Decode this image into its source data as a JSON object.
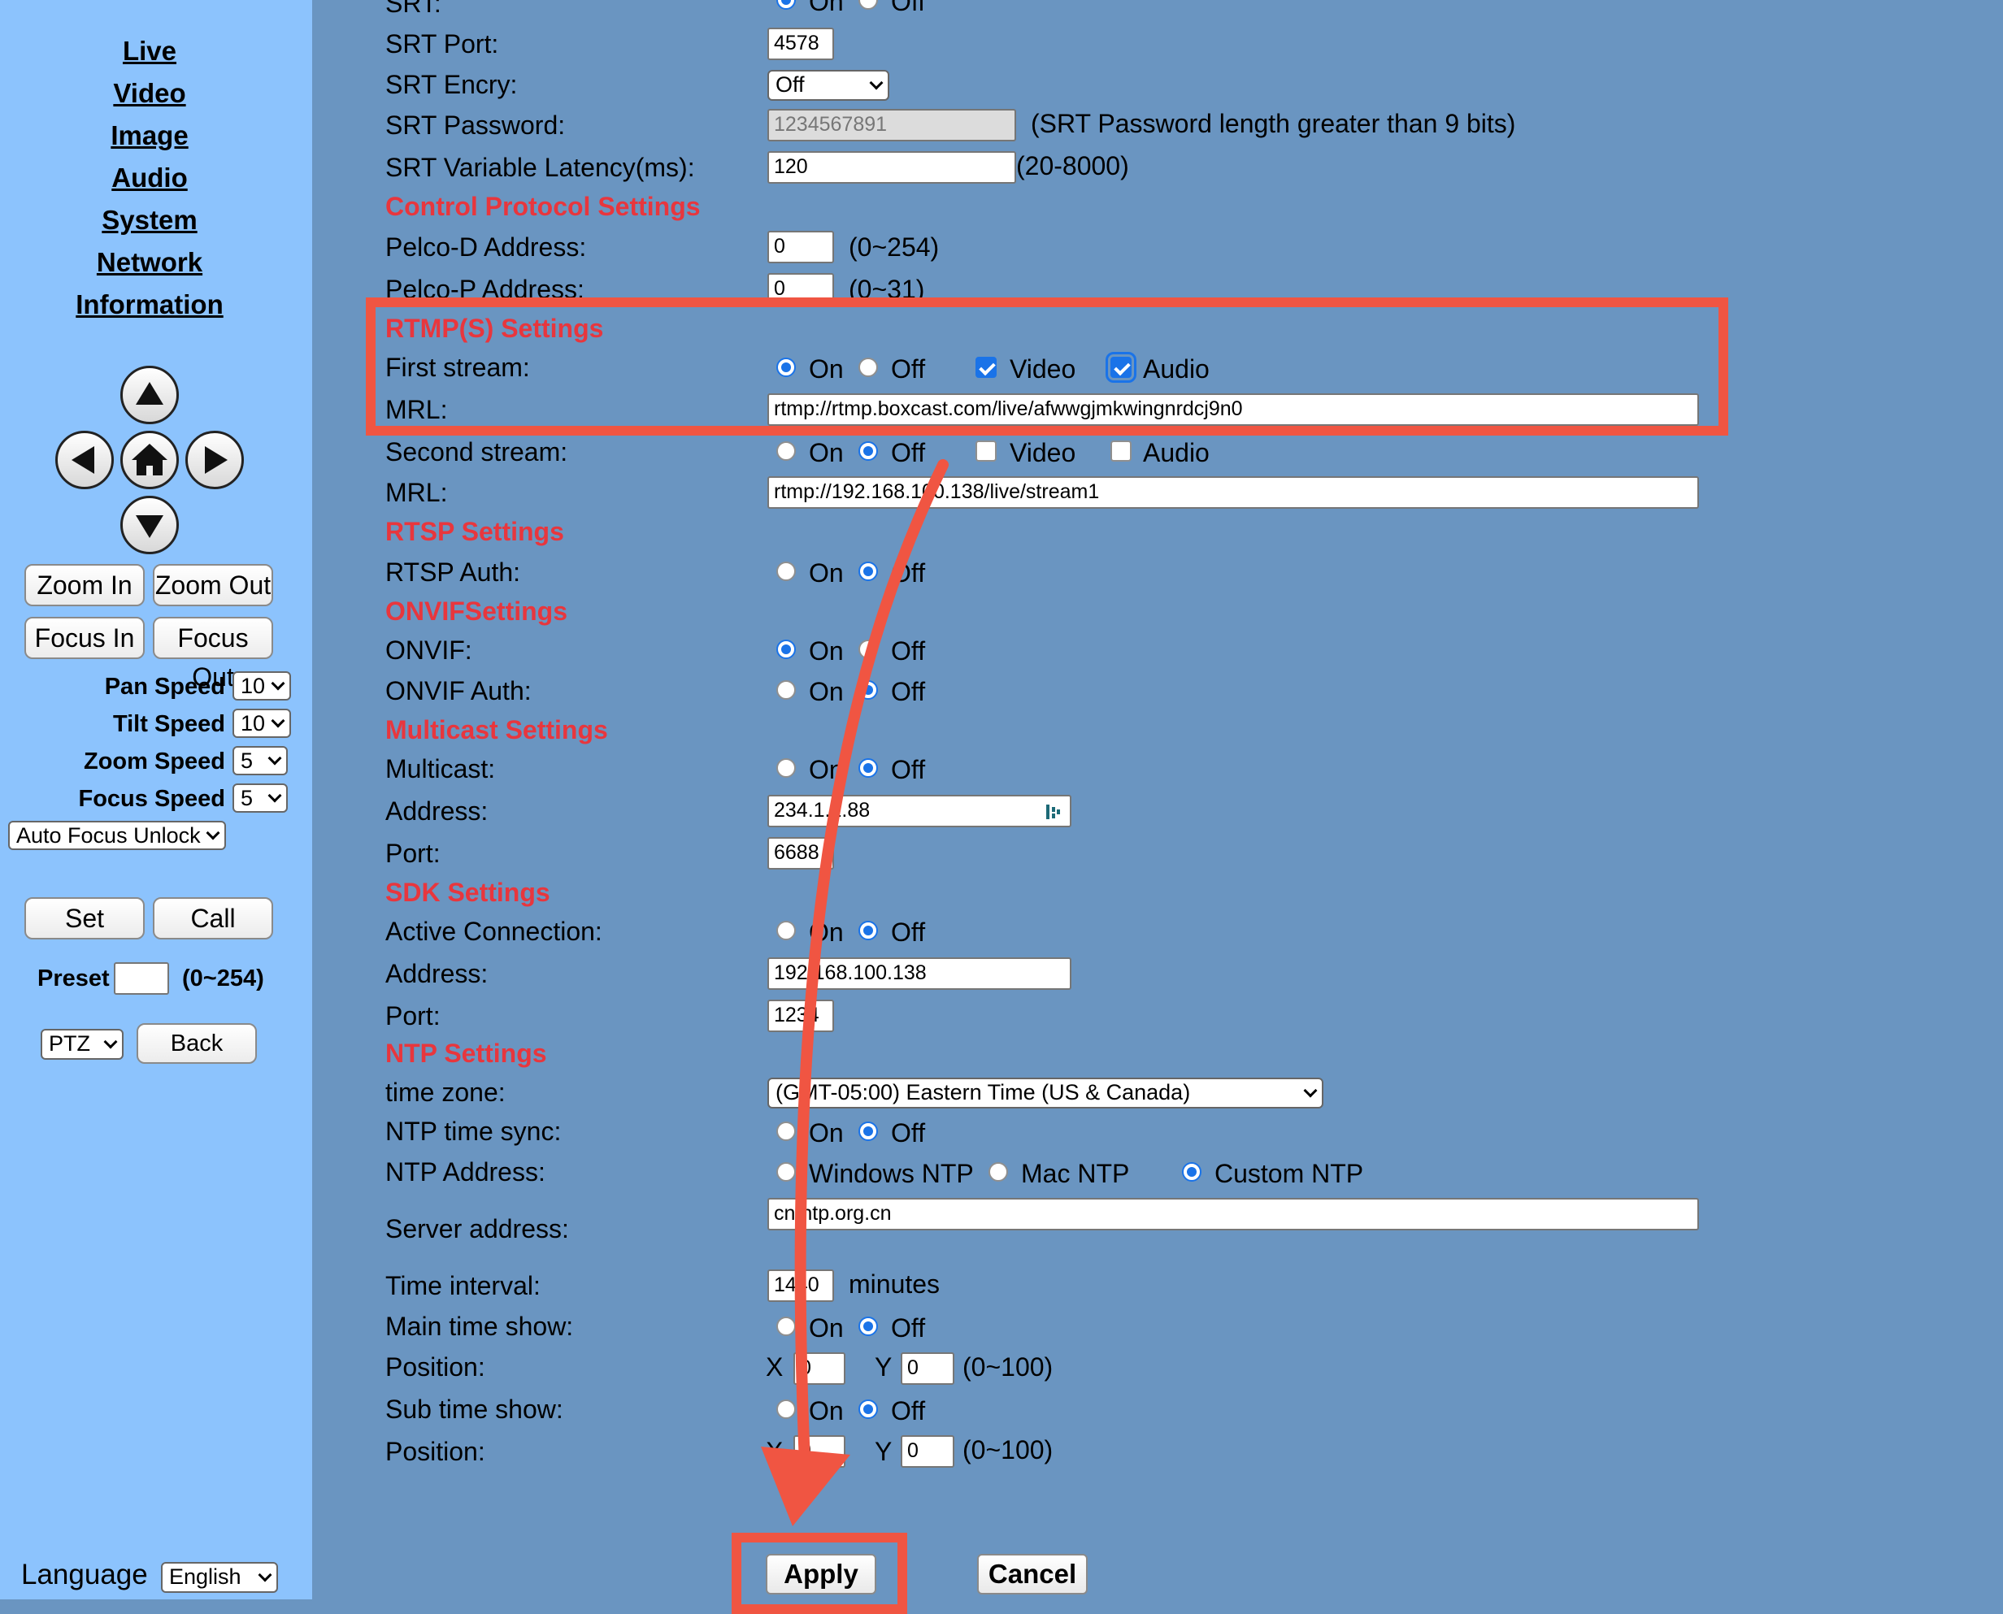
{
  "sidebar": {
    "nav": [
      "Live",
      "Video",
      "Image",
      "Audio",
      "System",
      "Network",
      "Information"
    ],
    "buttons": {
      "zoom_in": "Zoom In",
      "zoom_out": "Zoom Out",
      "focus_in": "Focus In",
      "focus_out": "Focus Out",
      "set": "Set",
      "call": "Call",
      "back": "Back"
    },
    "speeds": [
      {
        "label": "Pan Speed",
        "value": "10"
      },
      {
        "label": "Tilt Speed",
        "value": "10"
      },
      {
        "label": "Zoom Speed",
        "value": "5"
      },
      {
        "label": "Focus Speed",
        "value": "5"
      }
    ],
    "auto_focus": "Auto Focus Unlock",
    "preset_label": "Preset",
    "preset_value": "",
    "preset_range": "(0~254)",
    "ptz_mode": "PTZ",
    "language_label": "Language",
    "language_value": "English",
    "icons": [
      "up-arrow-icon",
      "left-arrow-icon",
      "home-icon",
      "right-arrow-icon",
      "down-arrow-icon"
    ]
  },
  "common": {
    "on": "On",
    "off": "Off",
    "video": "Video",
    "audio": "Audio",
    "x": "X",
    "y": "Y",
    "range_0_100": "(0~100)"
  },
  "srt": {
    "label": "SRT:",
    "on": true,
    "port_label": "SRT Port:",
    "port": "4578",
    "encry_label": "SRT Encry:",
    "encry": "Off",
    "password_label": "SRT Password:",
    "password": "1234567891",
    "password_note": "(SRT Password length greater than 9 bits)",
    "latency_label": "SRT Variable Latency(ms):",
    "latency": "120",
    "latency_range": "(20-8000)"
  },
  "control": {
    "title": "Control Protocol Settings",
    "pelco_d_label": "Pelco-D Address:",
    "pelco_d": "0",
    "pelco_d_range": "(0~254)",
    "pelco_p_label": "Pelco-P Address:",
    "pelco_p": "0",
    "pelco_p_range": "(0~31)"
  },
  "rtmp": {
    "title": "RTMP(S) Settings",
    "first_label": "First stream:",
    "first_on": true,
    "first_video": true,
    "first_audio": true,
    "mrl_label": "MRL:",
    "first_mrl": "rtmp://rtmp.boxcast.com/live/afwwgjmkwingnrdcj9n0",
    "second_label": "Second stream:",
    "second_on": false,
    "second_video": false,
    "second_audio": false,
    "second_mrl": "rtmp://192.168.100.138/live/stream1"
  },
  "rtsp": {
    "title": "RTSP Settings",
    "auth_label": "RTSP Auth:",
    "auth_on": false
  },
  "onvif": {
    "title": "ONVIFSettings",
    "onvif_label": "ONVIF:",
    "onvif_on": true,
    "auth_label": "ONVIF Auth:",
    "auth_on": false
  },
  "multicast": {
    "title": "Multicast Settings",
    "multicast_label": "Multicast:",
    "multicast_on": false,
    "address_label": "Address:",
    "address": "234.1.2.88",
    "port_label": "Port:",
    "port": "6688"
  },
  "sdk": {
    "title": "SDK Settings",
    "active_label": "Active Connection:",
    "active_on": false,
    "address_label": "Address:",
    "address": "192.168.100.138",
    "port_label": "Port:",
    "port": "1234"
  },
  "ntp": {
    "title": "NTP Settings",
    "tz_label": "time zone:",
    "tz": "(GMT-05:00) Eastern Time (US & Canada)",
    "sync_label": "NTP time sync:",
    "sync_on": false,
    "addr_label": "NTP Address:",
    "windows": "Windows NTP",
    "mac": "Mac NTP",
    "custom": "Custom NTP",
    "selected": "custom",
    "server_label": "Server address:",
    "server": "cn.ntp.org.cn",
    "interval_label": "Time interval:",
    "interval": "1440",
    "interval_unit": "minutes",
    "main_show_label": "Main time show:",
    "main_show_on": false,
    "position_label": "Position:",
    "main_x": "0",
    "main_y": "0",
    "sub_show_label": "Sub time show:",
    "sub_show_on": false,
    "sub_x": "0",
    "sub_y": "0"
  },
  "actions": {
    "apply": "Apply",
    "cancel": "Cancel"
  },
  "colors": {
    "section_title": "#e8363d",
    "annotation": "#f05542",
    "sidebar_bg": "#8cc3fd",
    "content_bg": "#6a95c1",
    "radio_accent": "#1a73e8"
  }
}
